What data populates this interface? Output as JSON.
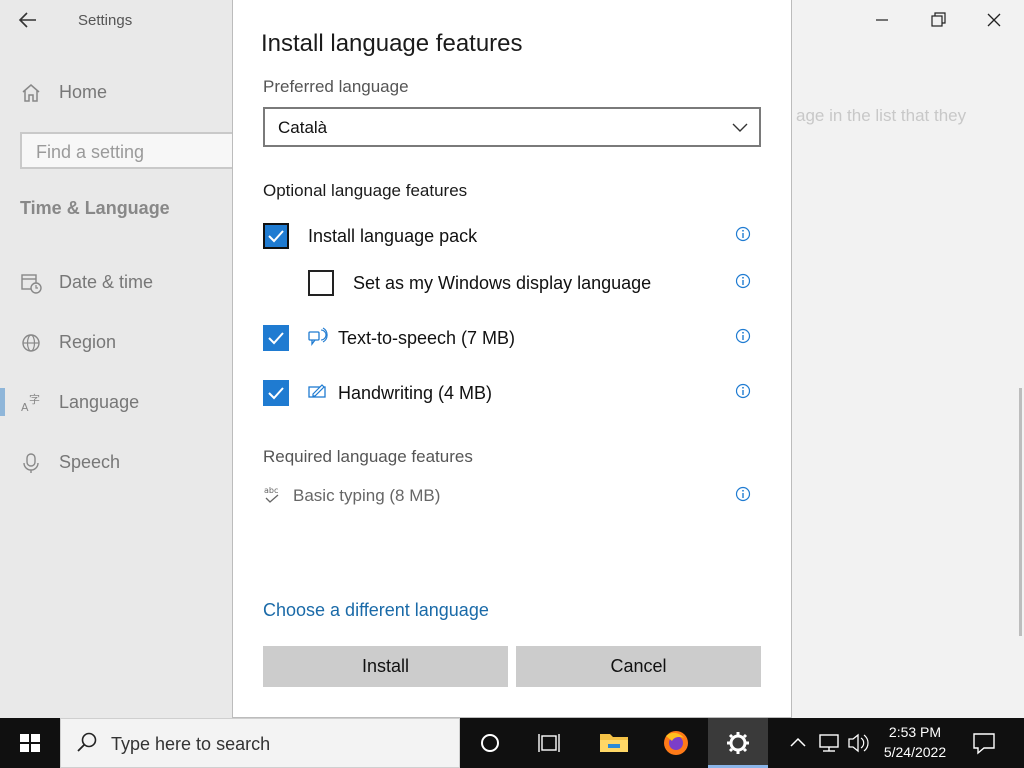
{
  "settings": {
    "app_title": "Settings",
    "sidebar": {
      "home_label": "Home",
      "search_placeholder": "Find a setting",
      "section_title": "Time & Language",
      "items": [
        {
          "label": "Date & time",
          "icon": "calendar-clock-icon"
        },
        {
          "label": "Region",
          "icon": "globe-icon"
        },
        {
          "label": "Language",
          "icon": "language-icon",
          "active": true
        },
        {
          "label": "Speech",
          "icon": "microphone-icon"
        }
      ]
    },
    "content_partial_text": "age in the list that they"
  },
  "dialog": {
    "title": "Install language features",
    "preferred_language_label": "Preferred language",
    "preferred_language_value": "Català",
    "optional_header": "Optional language features",
    "options": [
      {
        "label": "Install language pack",
        "checked": true
      },
      {
        "label": "Set as my Windows display language",
        "checked": false
      },
      {
        "label": "Text-to-speech (7 MB)",
        "checked": true,
        "icon": "speech-bubble-icon"
      },
      {
        "label": "Handwriting (4 MB)",
        "checked": true,
        "icon": "pen-icon"
      }
    ],
    "required_header": "Required language features",
    "required_items": [
      {
        "label": "Basic typing (8 MB)",
        "icon": "abc-check-icon"
      }
    ],
    "choose_link": "Choose a different language",
    "install_label": "Install",
    "cancel_label": "Cancel"
  },
  "taskbar": {
    "search_placeholder": "Type here to search",
    "time": "2:53 PM",
    "date": "5/24/2022"
  },
  "colors": {
    "accent": "#1f7bd1",
    "link": "#1a6aa8",
    "taskbar": "#101010"
  }
}
